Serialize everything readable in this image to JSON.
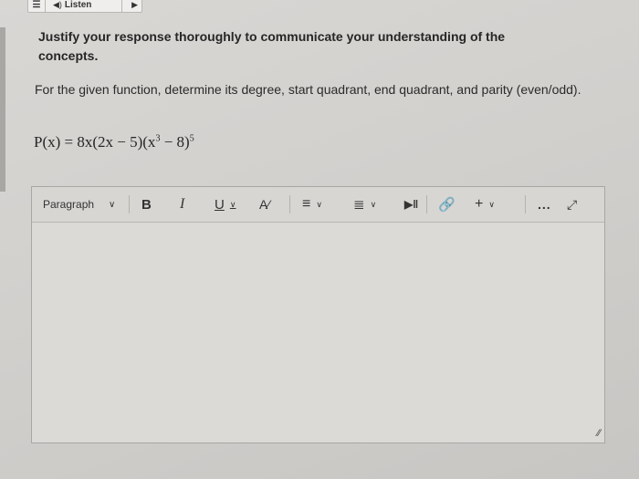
{
  "listen": {
    "label": "Listen",
    "menu_icon": "menu-icon",
    "speaker_icon": "speaker-icon",
    "play_icon": "play-icon"
  },
  "instructions": "Justify your response thoroughly to communicate your understanding of the concepts.",
  "question": "For the given function, determine its degree, start quadrant, end quadrant, and parity (even/odd).",
  "formula": {
    "lhs": "P(x) = 8x(2x − 5)(x",
    "exp_inner": "3",
    "mid": " − 8)",
    "exp_outer": "5"
  },
  "editor": {
    "paragraph_label": "Paragraph",
    "bold_label": "B",
    "italic_label": "I",
    "underline_label": "U",
    "format_icon": "text-format-icon",
    "align_icon": "align-icon",
    "list_icon": "list-icon",
    "media_icon": "media-icon",
    "link_icon": "link-icon",
    "plus_label": "+",
    "more_label": "...",
    "expand_icon": "expand-icon",
    "resize_icon": "resize-handle-icon"
  }
}
